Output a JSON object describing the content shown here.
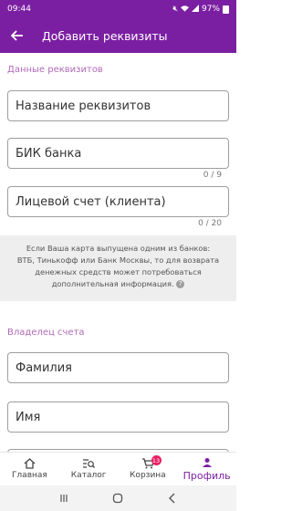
{
  "status": {
    "time": "09:44",
    "battery": "97%"
  },
  "header": {
    "title": "Добавить реквизиты"
  },
  "details": {
    "section_title": "Данные реквизитов",
    "name_placeholder": "Название реквизитов",
    "bik_placeholder": "БИК банка",
    "bik_counter": "0 / 9",
    "account_placeholder": "Лицевой счет (клиента)",
    "account_counter": "0 / 20"
  },
  "info": {
    "line1": "Если Ваша карта выпущена одним из банков:",
    "line2": "ВТБ, Тинькофф или Банк Москвы, то для возврата",
    "line3": "денежных средств может потребоваться",
    "line4": "дополнительная информация."
  },
  "owner": {
    "section_title": "Владелец счета",
    "surname_placeholder": "Фамилия",
    "name_placeholder": "Имя"
  },
  "tabs": {
    "home": "Главная",
    "catalog": "Каталог",
    "cart": "Корзина",
    "cart_badge": "13",
    "profile": "Профиль"
  },
  "colors": {
    "primary": "#7b1fa2",
    "accent": "#b06ab8",
    "badge": "#e91e63"
  }
}
